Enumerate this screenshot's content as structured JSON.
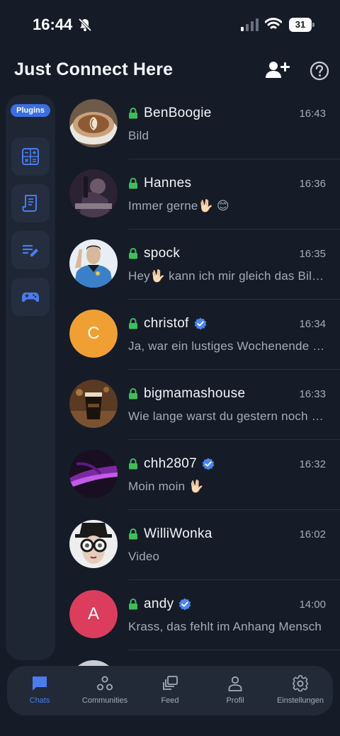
{
  "status_bar": {
    "time": "16:44",
    "battery": "31"
  },
  "header": {
    "title": "Just Connect Here",
    "add_user_icon": "add-user-icon",
    "help_icon": "help-icon"
  },
  "sidebar": {
    "badge": "Plugins",
    "plugins": [
      {
        "icon": "calculator-icon"
      },
      {
        "icon": "receipt-icon"
      },
      {
        "icon": "notes-edit-icon"
      },
      {
        "icon": "gamepad-icon"
      }
    ]
  },
  "chats": [
    {
      "name": "BenBoogie",
      "time": "16:43",
      "preview": "Bild",
      "verified": false
    },
    {
      "name": "Hannes",
      "time": "16:36",
      "preview": "Immer gerne🖖🏻 😊",
      "verified": false
    },
    {
      "name": "spock",
      "time": "16:35",
      "preview": "Hey🖖🏻  kann ich mir gleich das Bild anschauen",
      "verified": false
    },
    {
      "name": "christof",
      "time": "16:34",
      "preview": "Ja, war ein lustiges Wochenende mit euch",
      "verified": true,
      "avatar_letter": "C",
      "avatar_color": "#f0a033"
    },
    {
      "name": "bigmamashouse",
      "time": "16:33",
      "preview": "Wie lange warst du gestern noch unterwegs?",
      "verified": false
    },
    {
      "name": "chh2807",
      "time": "16:32",
      "preview": "Moin moin 🖖🏻",
      "verified": true
    },
    {
      "name": "WilliWonka",
      "time": "16:02",
      "preview": "Video",
      "verified": false
    },
    {
      "name": "andy",
      "time": "14:00",
      "preview": "Krass, das fehlt im Anhang Mensch",
      "verified": true,
      "avatar_letter": "A",
      "avatar_color": "#dc3d5d"
    }
  ],
  "bottom_nav": {
    "items": [
      {
        "label": "Chats",
        "icon": "chat-icon",
        "active": true
      },
      {
        "label": "Communities",
        "icon": "communities-icon"
      },
      {
        "label": "Feed",
        "icon": "feed-icon"
      },
      {
        "label": "Profil",
        "icon": "profile-icon"
      },
      {
        "label": "Einstellungen",
        "icon": "settings-icon"
      }
    ]
  },
  "colors": {
    "accent": "#3a6fe3",
    "background": "#151b27",
    "lock": "#3fbf5a",
    "verified": "#4a86f0"
  }
}
